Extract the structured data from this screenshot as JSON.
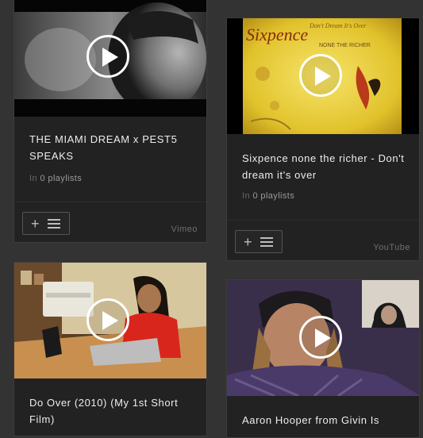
{
  "videos": [
    {
      "title": "THE MIAMI DREAM x PEST5 SPEAKS",
      "playlists_prefix": "In",
      "playlists_count": "0 playlists",
      "source": "Vimeo"
    },
    {
      "title": "Sixpence none the richer - Don't dream it's over",
      "playlists_prefix": "In",
      "playlists_count": "0 playlists",
      "source": "YouTube",
      "thumb_text": "Sixpence",
      "thumb_subtext": "NONE THE RICHER",
      "thumb_script": "Don't Dream It's Over"
    },
    {
      "title": "Do Over (2010) (My 1st Short Film)"
    },
    {
      "title": "Aaron Hooper from Givin Is"
    }
  ],
  "icons": {
    "play": "play-icon",
    "add": "plus-icon",
    "playlist": "list-icon"
  }
}
